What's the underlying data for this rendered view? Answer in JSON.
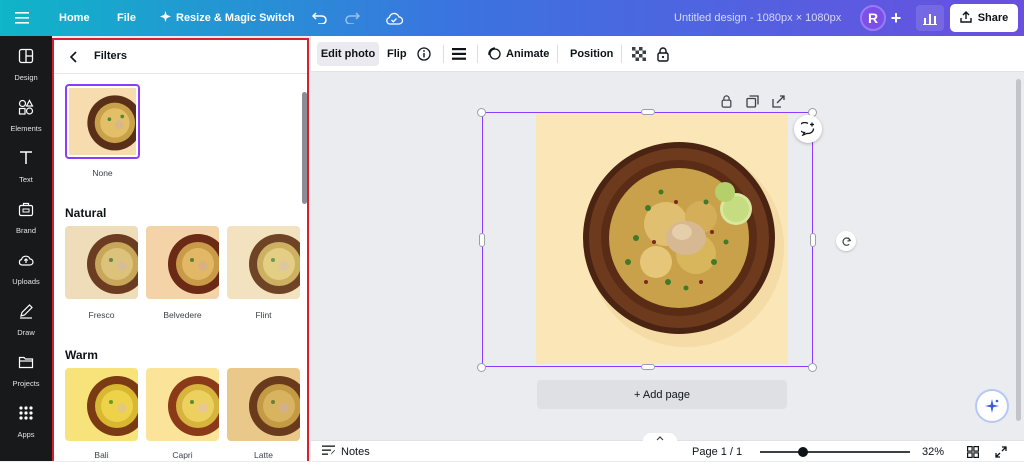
{
  "topbar": {
    "home_label": "Home",
    "file_label": "File",
    "resize_label": "Resize & Magic Switch",
    "design_title": "Untitled design - 1080px × 1080px",
    "avatar_initial": "R",
    "share_label": "Share",
    "plus_label": "+"
  },
  "rail": {
    "items": [
      {
        "label": "Design",
        "icon": "design-icon"
      },
      {
        "label": "Elements",
        "icon": "elements-icon"
      },
      {
        "label": "Text",
        "icon": "text-icon"
      },
      {
        "label": "Brand",
        "icon": "brand-icon"
      },
      {
        "label": "Uploads",
        "icon": "uploads-icon"
      },
      {
        "label": "Draw",
        "icon": "draw-icon"
      },
      {
        "label": "Projects",
        "icon": "folder-icon"
      },
      {
        "label": "Apps",
        "icon": "apps-grid-icon"
      }
    ]
  },
  "panel": {
    "title": "Filters",
    "none_label": "None",
    "sections": [
      {
        "title": "Natural",
        "filters": [
          "Fresco",
          "Belvedere",
          "Flint"
        ]
      },
      {
        "title": "Warm",
        "filters": [
          "Bali",
          "Capri",
          "Latte"
        ]
      }
    ]
  },
  "toolbar": {
    "edit_photo": "Edit photo",
    "flip": "Flip",
    "animate": "Animate",
    "position": "Position"
  },
  "canvas": {
    "add_page": "+ Add page"
  },
  "bottombar": {
    "notes": "Notes",
    "page_indicator": "Page 1 / 1",
    "zoom": "32%",
    "zoom_fraction": 0.32
  },
  "colors": {
    "accent_purple": "#8b3dff",
    "highlight_red": "#d6202f",
    "rail_bg": "#18191b",
    "design_bg": "#fbe6b8"
  }
}
